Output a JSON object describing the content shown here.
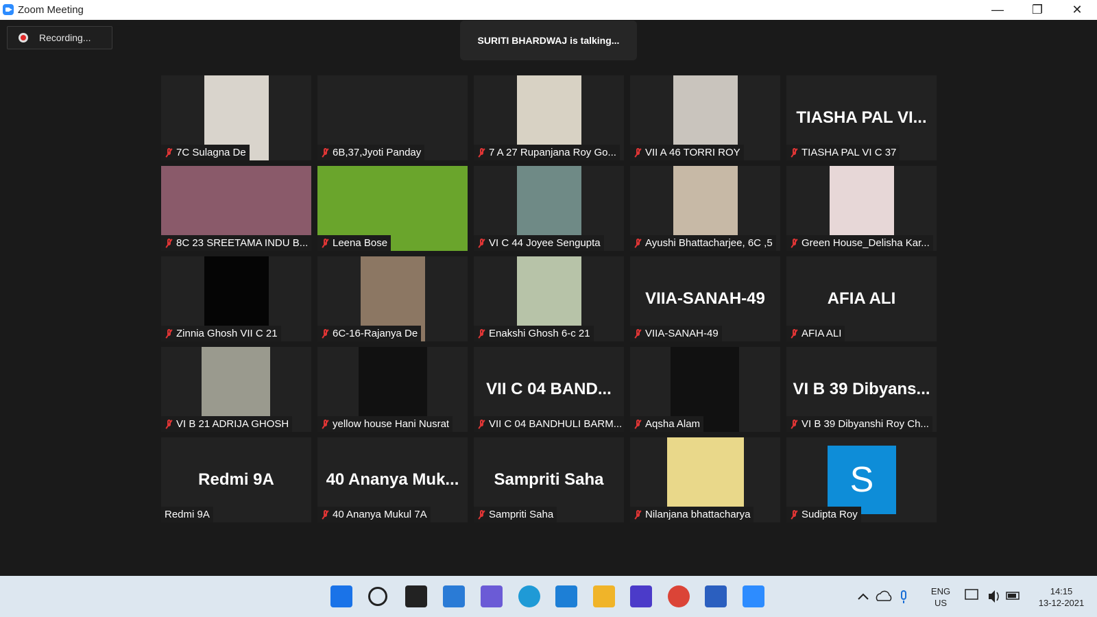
{
  "window": {
    "title": "Zoom Meeting",
    "minimize_glyph": "—",
    "restore_glyph": "❐",
    "close_glyph": "✕"
  },
  "recording": {
    "label": "Recording..."
  },
  "talking": {
    "text": "SURITI BHARDWAJ is talking..."
  },
  "participants": [
    {
      "name": "7C Sulagna De",
      "muted": true,
      "video": "photo",
      "photo_color": "#d9d4cc",
      "big": ""
    },
    {
      "name": "6B,37,Jyoti Panday",
      "muted": true,
      "video": "none",
      "big": ""
    },
    {
      "name": "7 A 27 Rupanjana Roy Go...",
      "muted": true,
      "video": "photo",
      "photo_color": "#d8d2c4",
      "big": ""
    },
    {
      "name": "VII A 46 TORRI ROY",
      "muted": true,
      "video": "photo",
      "photo_color": "#c9c4bd",
      "big": ""
    },
    {
      "name": "TIASHA PAL VI C 37",
      "muted": true,
      "video": "name",
      "big": "TIASHA PAL VI..."
    },
    {
      "name": "8C 23 SREETAMA INDU B...",
      "muted": true,
      "video": "wide",
      "photo_color": "#8a5a6a",
      "big": ""
    },
    {
      "name": "Leena Bose",
      "muted": true,
      "video": "wide",
      "photo_color": "#6aa52c",
      "big": ""
    },
    {
      "name": "VI C 44 Joyee Sengupta",
      "muted": true,
      "video": "photo",
      "photo_color": "#6f8a86",
      "big": ""
    },
    {
      "name": "Ayushi Bhattacharjee, 6C ,5",
      "muted": true,
      "video": "photo",
      "photo_color": "#c7b9a6",
      "big": ""
    },
    {
      "name": "Green House_Delisha Kar...",
      "muted": true,
      "video": "photo",
      "photo_color": "#e7d7d7",
      "big": ""
    },
    {
      "name": "Zinnia Ghosh VII C 21",
      "muted": true,
      "video": "photo",
      "photo_color": "#050505",
      "big": ""
    },
    {
      "name": "6C-16-Rajanya De",
      "muted": true,
      "video": "photo",
      "photo_color": "#8c7763",
      "big": ""
    },
    {
      "name": "Enakshi Ghosh 6-c 21",
      "muted": true,
      "video": "photo",
      "photo_color": "#b7c3a8",
      "big": ""
    },
    {
      "name": "VIIA-SANAH-49",
      "muted": true,
      "video": "name",
      "big": "VIIA-SANAH-49"
    },
    {
      "name": "AFIA ALI",
      "muted": true,
      "video": "name",
      "big": "AFIA ALI"
    },
    {
      "name": "VI B 21 ADRIJA GHOSH",
      "muted": true,
      "video": "photo",
      "photo_color": "#9a9a8e",
      "big": ""
    },
    {
      "name": "yellow house Hani Nusrat",
      "muted": true,
      "video": "photo",
      "photo_color": "#111111",
      "big": ""
    },
    {
      "name": "VII C 04 BANDHULI BARM...",
      "muted": true,
      "video": "name",
      "big": "VII C 04 BAND..."
    },
    {
      "name": "Aqsha Alam",
      "muted": true,
      "video": "photo",
      "photo_color": "#111111",
      "big": ""
    },
    {
      "name": "VI B 39 Dibyanshi Roy Ch...",
      "muted": true,
      "video": "name",
      "big": "VI B 39 Dibyans..."
    },
    {
      "name": "Redmi 9A",
      "muted": false,
      "video": "name",
      "big": "Redmi 9A"
    },
    {
      "name": "40 Ananya Mukul 7A",
      "muted": true,
      "video": "name",
      "big": "40 Ananya Muk..."
    },
    {
      "name": "Sampriti Saha",
      "muted": true,
      "video": "name",
      "big": "Sampriti Saha"
    },
    {
      "name": "Nilanjana bhattacharya",
      "muted": true,
      "video": "photo",
      "photo_color": "#e9d88a",
      "big": ""
    },
    {
      "name": "Sudipta Roy",
      "muted": true,
      "video": "avatar",
      "big": "S"
    }
  ],
  "taskbar": {
    "apps": [
      {
        "name": "start-icon",
        "color": "#1a73e8"
      },
      {
        "name": "search-icon",
        "color": "#222222"
      },
      {
        "name": "task-view-icon",
        "color": "#222222"
      },
      {
        "name": "widgets-icon",
        "color": "#2a7bd6"
      },
      {
        "name": "chat-icon",
        "color": "#6b5bd6"
      },
      {
        "name": "edge-icon",
        "color": "#1f9ad6"
      },
      {
        "name": "mail-icon",
        "color": "#1d7fd6"
      },
      {
        "name": "file-explorer-icon",
        "color": "#f0b429"
      },
      {
        "name": "whiteboard-icon",
        "color": "#4b3bc9"
      },
      {
        "name": "chrome-icon",
        "color": "#db4437"
      },
      {
        "name": "word-icon",
        "color": "#2b5fbf"
      },
      {
        "name": "zoom-icon",
        "color": "#2d8cff"
      }
    ],
    "lang_line1": "ENG",
    "lang_line2": "US",
    "time": "14:15",
    "date": "13-12-2021"
  }
}
